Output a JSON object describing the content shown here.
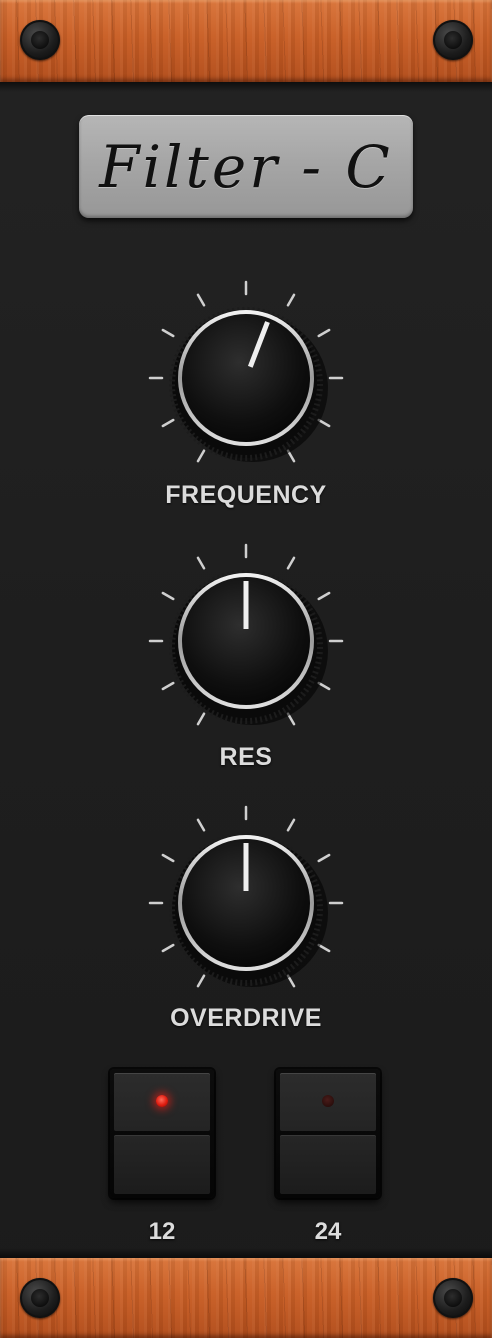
{
  "module": {
    "title": "Filter - C",
    "knobs": [
      {
        "label": "FREQUENCY",
        "value": 0.57
      },
      {
        "label": "RES",
        "value": 0.5
      },
      {
        "label": "OVERDRIVE",
        "value": 0.5
      }
    ],
    "slope_switches": [
      {
        "label": "12",
        "led": "on"
      },
      {
        "label": "24",
        "led": "off"
      }
    ]
  },
  "colors": {
    "panel": "#1e1e1e",
    "wood": "#c95f26",
    "label_text": "#dcdcdc",
    "led_on": "#e01d10",
    "led_off": "#2b0e0c"
  }
}
